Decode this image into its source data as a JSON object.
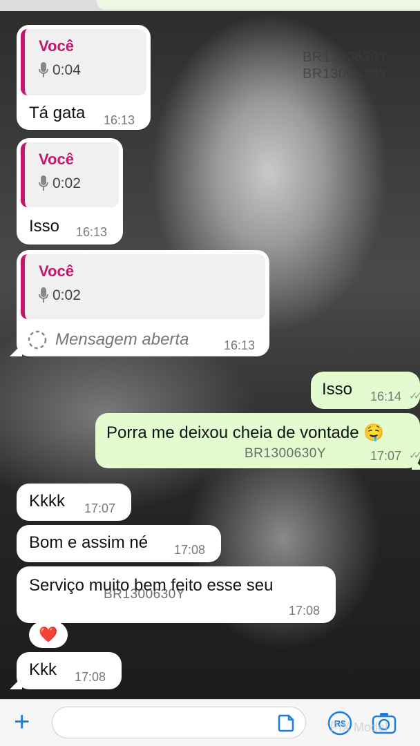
{
  "watermarks": [
    "BR1300630Y",
    "BR1300630Y",
    "BR1300630Y",
    "BR1300630Y"
  ],
  "messages": [
    {
      "quote_name": "Você",
      "quote_duration": "0:04",
      "text": "Tá gata",
      "time": "16:13"
    },
    {
      "quote_name": "Você",
      "quote_duration": "0:02",
      "text": "Isso",
      "time": "16:13"
    },
    {
      "quote_name": "Você",
      "quote_duration": "0:02",
      "text": "Mensagem aberta",
      "time": "16:13"
    },
    {
      "text": "Isso",
      "time": "16:14"
    },
    {
      "text": "Porra me deixou cheia de vontade 🤤",
      "time": "17:07"
    },
    {
      "text": "Kkkk",
      "time": "17:07"
    },
    {
      "text": "Bom e assim né",
      "time": "17:08"
    },
    {
      "text": "Serviço muito bem feito esse seu",
      "time": "17:08"
    },
    {
      "text": "Kkk",
      "time": "17:08"
    }
  ],
  "reaction": "❤️",
  "composer": {
    "plus": "+",
    "pix_watermark": "PIX Model"
  },
  "colors": {
    "accent_magenta": "#c3176d",
    "outgoing_bubble": "#e2fbcf",
    "ios_blue": "#1b7fe0"
  }
}
